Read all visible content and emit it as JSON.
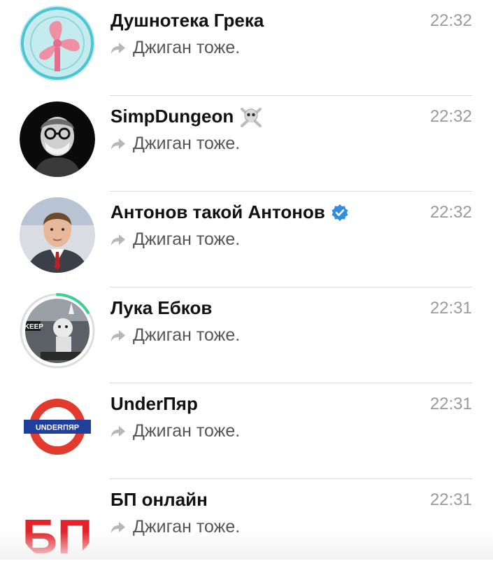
{
  "chats": [
    {
      "name": "Душнотека Грека",
      "time": "22:32",
      "preview": "Джиган тоже.",
      "avatar_icon": "fan-icon",
      "emoji": ""
    },
    {
      "name": "SimpDungeon",
      "time": "22:32",
      "preview": "Джиган тоже.",
      "avatar_icon": "masked-man-icon",
      "emoji": "skull-crossbones-icon"
    },
    {
      "name": "Антонов такой Антонов",
      "time": "22:32",
      "preview": "Джиган тоже.",
      "avatar_icon": "man-in-suit-icon",
      "emoji": "verified-badge-icon"
    },
    {
      "name": "Лука Ебков",
      "time": "22:31",
      "preview": "Джиган тоже.",
      "avatar_icon": "cartoon-keep-icon",
      "avatar_text": "\"KEEP",
      "emoji": ""
    },
    {
      "name": "UnderПяр",
      "time": "22:31",
      "preview": "Джиган тоже.",
      "avatar_icon": "underground-roundel-icon",
      "avatar_text": "UNDERПЯР",
      "emoji": ""
    },
    {
      "name": "БП онлайн",
      "time": "22:31",
      "preview": "Джиган тоже.",
      "avatar_icon": "bp-logo-icon",
      "avatar_text": "БП",
      "emoji": ""
    }
  ],
  "colors": {
    "accent": "#2f8de4",
    "time": "#9a9a9a",
    "separator": "#dcdcdc",
    "forward_icon": "#b7b7b7"
  }
}
